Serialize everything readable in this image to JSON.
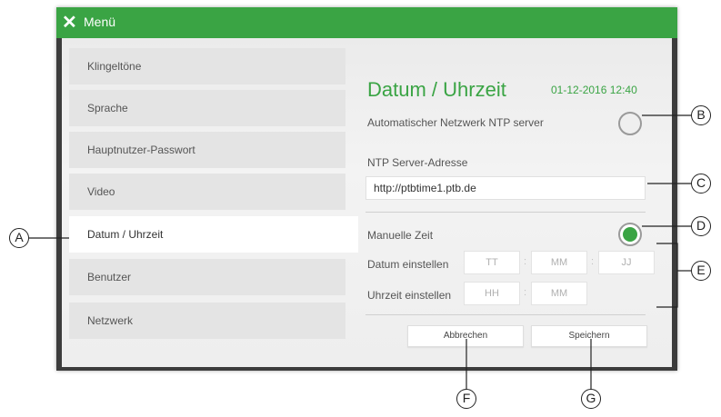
{
  "window": {
    "title": "Menü",
    "close_glyph": "✕"
  },
  "sidebar": {
    "items": [
      {
        "label": "Klingeltöne"
      },
      {
        "label": "Sprache"
      },
      {
        "label": "Hauptnutzer-Passwort"
      },
      {
        "label": "Video"
      },
      {
        "label": "Datum / Uhrzeit",
        "active": true
      },
      {
        "label": "Benutzer"
      },
      {
        "label": "Netzwerk"
      }
    ]
  },
  "main": {
    "title": "Datum / Uhrzeit",
    "datetime": "01-12-2016 12:40",
    "ntp_auto_label": "Automatischer Netzwerk NTP server",
    "ntp_auto_on": false,
    "ntp_address_label": "NTP Server-Adresse",
    "ntp_address_value": "http://ptbtime1.ptb.de",
    "manual_label": "Manuelle Zeit",
    "manual_on": true,
    "date_label": "Datum einstellen",
    "date_placeholders": [
      "TT",
      "MM",
      "JJ"
    ],
    "time_label": "Uhrzeit einstellen",
    "time_placeholders": [
      "HH",
      "MM"
    ],
    "separator": ":",
    "cancel_label": "Abbrechen",
    "save_label": "Speichern"
  },
  "callouts": {
    "a": "A",
    "b": "B",
    "c": "C",
    "d": "D",
    "e": "E",
    "f": "F",
    "g": "G"
  },
  "colors": {
    "accent": "#3aa444",
    "frame": "#3c3c3c"
  },
  "icons": {
    "close": "close-icon"
  }
}
